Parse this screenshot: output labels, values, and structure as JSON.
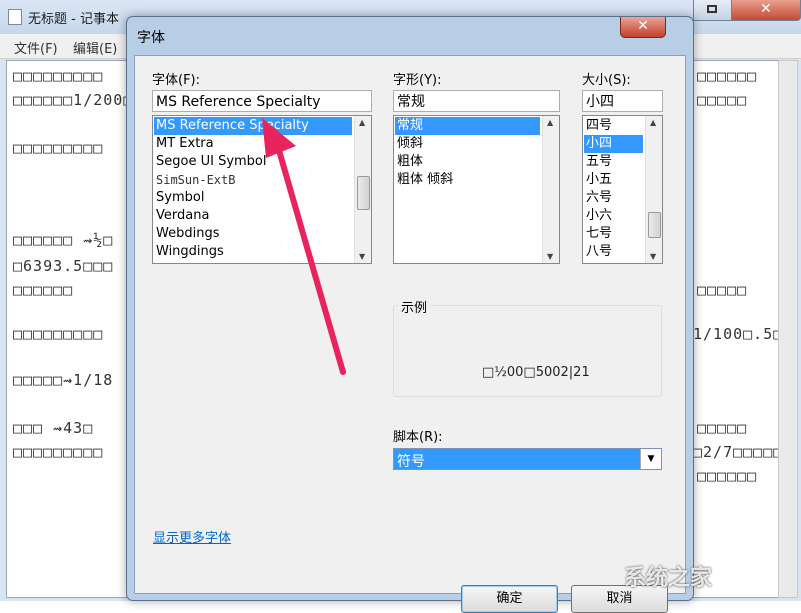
{
  "notepad": {
    "title": "无标题 - 记事本",
    "menu": [
      "文件(F)",
      "编辑(E)"
    ],
    "lines_left": [
      "□□□□□□□□□",
      "□□□□□□1/200□",
      "□□□□□□□□□",
      "□□□□□□ ⇝½□",
      "□6393.5□□□",
      "□□□□□□",
      "□□□□□□□□□",
      "□□□□□⇝1/18",
      "□□□ ⇝43□",
      "□□□□□□□□□"
    ],
    "lines_right": [
      "□□□□□□",
      "□□□□□",
      "□□□□□",
      "1/100□.5□□",
      "□□□□□",
      "□2/7□□□□□",
      "□□□□□□"
    ]
  },
  "dialog": {
    "title": "字体",
    "close_glyph": "✕",
    "font": {
      "label": "字体(F):",
      "value": "MS Reference Specialty",
      "items": [
        "MS Reference Specialty",
        "MT Extra",
        "Segoe UI Symbol",
        "SimSun-ExtB",
        "Symbol",
        "Verdana",
        "Webdings",
        "Wingdings"
      ],
      "selected_index": 0
    },
    "style": {
      "label": "字形(Y):",
      "value": "常规",
      "items": [
        "常规",
        "倾斜",
        "粗体",
        "粗体 倾斜"
      ],
      "selected_index": 0
    },
    "size": {
      "label": "大小(S):",
      "value": "小四",
      "items": [
        "四号",
        "小四",
        "五号",
        "小五",
        "六号",
        "小六",
        "七号",
        "八号"
      ],
      "selected_index": 1
    },
    "sample": {
      "label": "示例",
      "text": "□½00□5002|21"
    },
    "script": {
      "label": "脚本(R):",
      "value": "符号"
    },
    "more_fonts_link": "显示更多字体",
    "ok_label": "确定",
    "cancel_label": "取消"
  },
  "watermark": "系统之家",
  "colors": {
    "selection": "#3399ff",
    "annotation_arrow": "#e8245e"
  }
}
